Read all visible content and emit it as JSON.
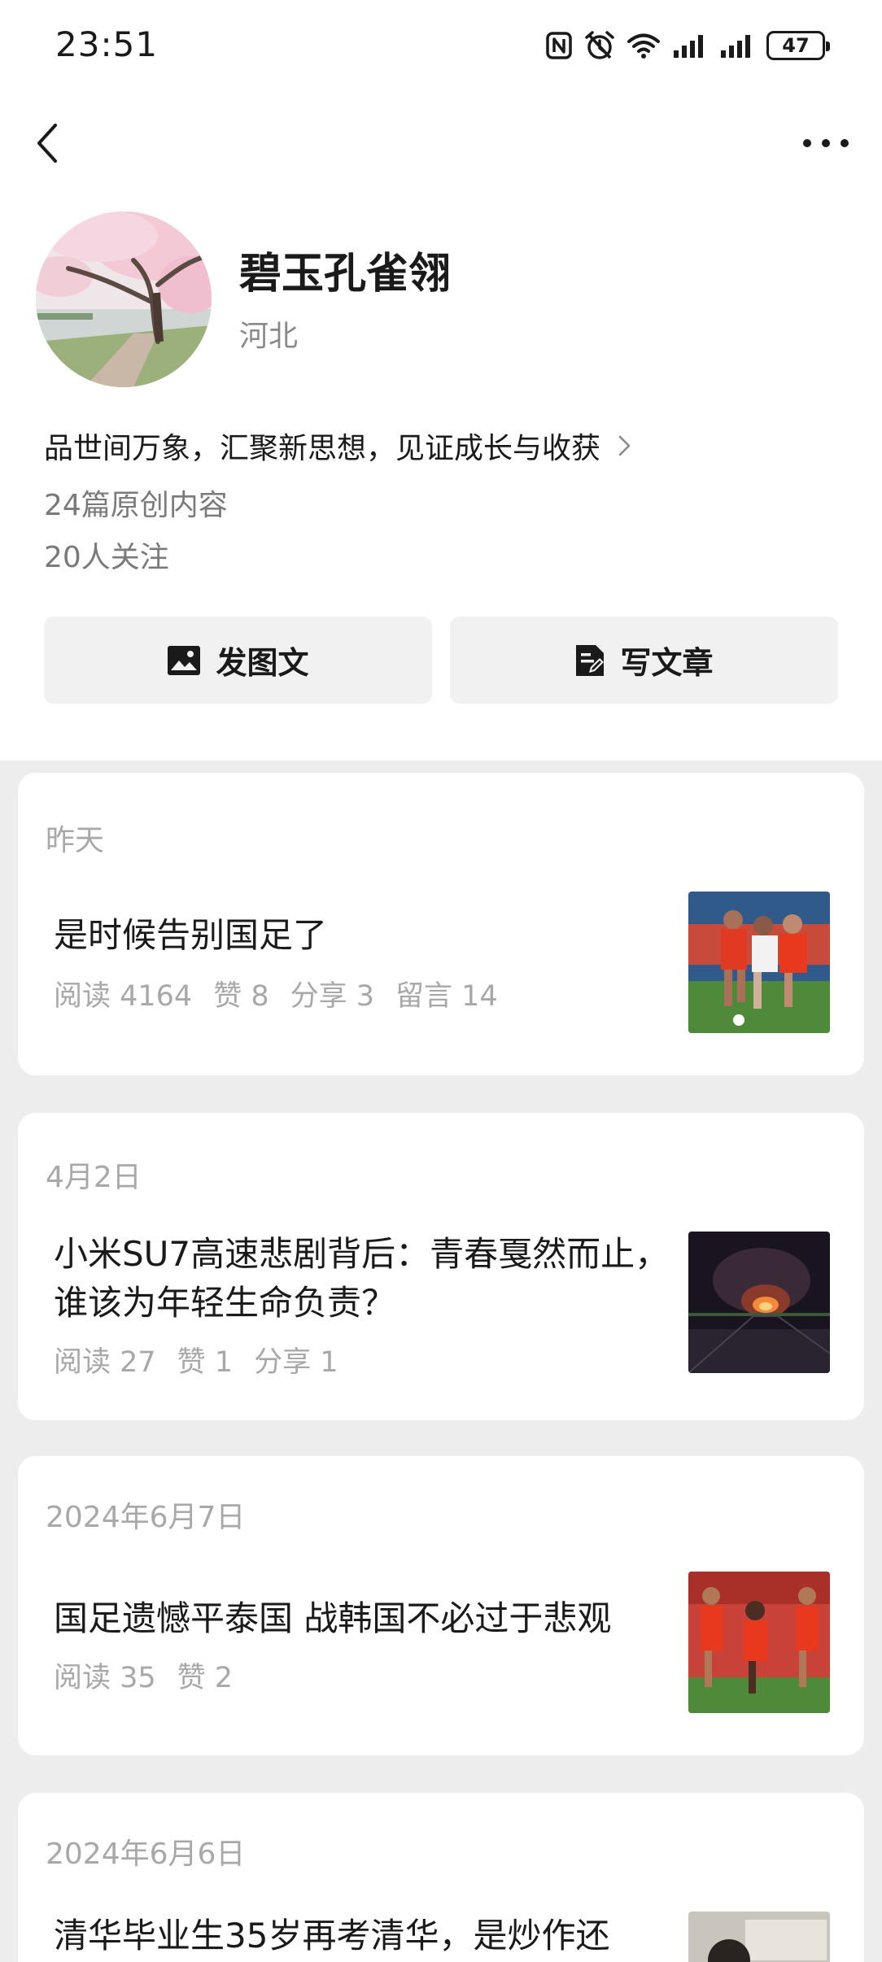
{
  "status_bar": {
    "time": "23:51",
    "battery": "47",
    "icons": [
      "nfc-icon",
      "alarm-icon",
      "wifi-icon",
      "signal-icon",
      "signal-icon",
      "battery-icon"
    ]
  },
  "nav": {
    "back_icon": "chevron-left-icon",
    "more_icon": "more-dots-icon"
  },
  "profile": {
    "nickname": "碧玉孔雀翎",
    "region": "河北",
    "bio": "品世间万象，汇聚新思想，见证成长与收获",
    "articles_count": "24篇原创内容",
    "followers_count": "20人关注"
  },
  "actions": {
    "post_image_text": "发图文",
    "write_article": "写文章"
  },
  "articles": [
    {
      "date": "昨天",
      "title": "是时候告别国足了",
      "stats": [
        "阅读 4164",
        "赞 8",
        "分享 3",
        "留言 14"
      ]
    },
    {
      "date": "4月2日",
      "title": "小米SU7高速悲剧背后：青春戛然而止，谁该为年轻生命负责？",
      "stats": [
        "阅读 27",
        "赞 1",
        "分享 1"
      ]
    },
    {
      "date": "2024年6月7日",
      "title": "国足遗憾平泰国 战韩国不必过于悲观",
      "stats": [
        "阅读 35",
        "赞 2"
      ]
    },
    {
      "date": "2024年6月6日",
      "title": "清华毕业生35岁再考清华，是炒作还",
      "stats": []
    }
  ]
}
